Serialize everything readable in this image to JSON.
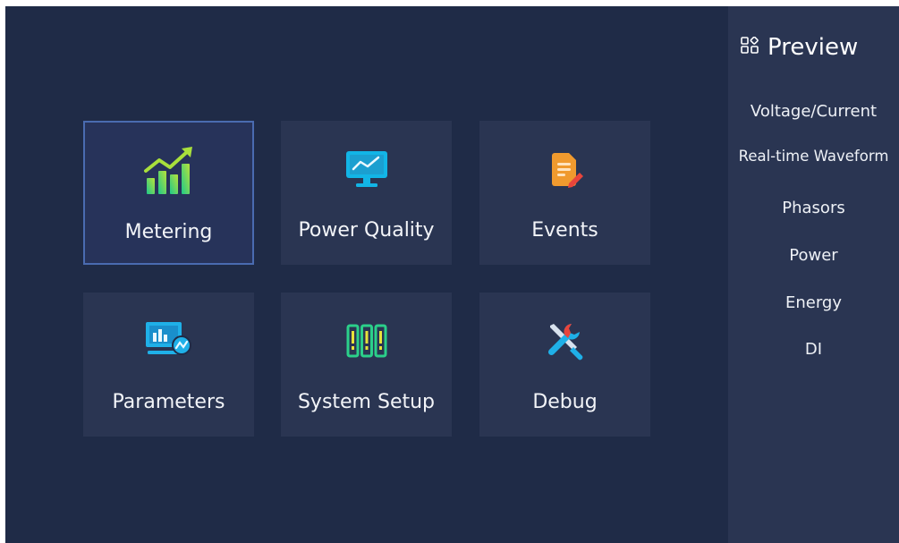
{
  "colors": {
    "main_background": "#1f2b47",
    "sidebar_background": "#2a3552",
    "tile_background": "#2a3552",
    "selected_border": "#4a6bb0",
    "text": "#f2f4f8"
  },
  "menu": {
    "tiles": [
      {
        "label": "Metering",
        "icon": "bar-chart-trend-icon",
        "selected": true
      },
      {
        "label": "Power Quality",
        "icon": "monitor-waveform-icon",
        "selected": false
      },
      {
        "label": "Events",
        "icon": "document-edit-icon",
        "selected": false
      },
      {
        "label": "Parameters",
        "icon": "monitor-chart-icon",
        "selected": false
      },
      {
        "label": "System Setup",
        "icon": "battery-columns-icon",
        "selected": false
      },
      {
        "label": "Debug",
        "icon": "tools-icon",
        "selected": false
      }
    ]
  },
  "sidebar": {
    "title": "Preview",
    "title_icon": "grid-apps-icon",
    "items": [
      {
        "label": "Voltage/Current"
      },
      {
        "label": "Real-time Waveform"
      },
      {
        "label": "Phasors"
      },
      {
        "label": "Power"
      },
      {
        "label": "Energy"
      },
      {
        "label": "DI"
      }
    ]
  }
}
